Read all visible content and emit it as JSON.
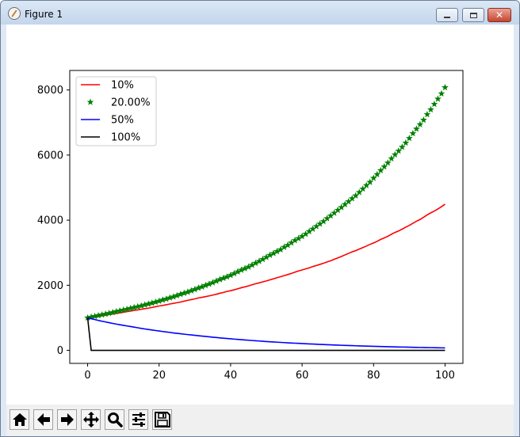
{
  "window": {
    "title": "Figure 1"
  },
  "toolbar": {
    "buttons": [
      {
        "name": "home",
        "icon": "home-icon"
      },
      {
        "name": "back",
        "icon": "arrow-left-icon"
      },
      {
        "name": "forward",
        "icon": "arrow-right-icon"
      },
      {
        "name": "pan",
        "icon": "move-icon"
      },
      {
        "name": "zoom",
        "icon": "magnifier-icon"
      },
      {
        "name": "configure-subplots",
        "icon": "sliders-icon"
      },
      {
        "name": "save",
        "icon": "floppy-disk-icon"
      }
    ]
  },
  "chart_data": {
    "type": "line",
    "title": "",
    "xlabel": "",
    "ylabel": "",
    "xlim": [
      -5,
      105
    ],
    "ylim": [
      -400,
      8600
    ],
    "xticks": [
      0,
      20,
      40,
      60,
      80,
      100
    ],
    "yticks": [
      0,
      2000,
      4000,
      6000,
      8000
    ],
    "legend_placement": "upper-left",
    "grid": false,
    "series": [
      {
        "name": "10%",
        "style": "line",
        "color": "#ff0000",
        "rate": 0.015,
        "n": 101
      },
      {
        "name": "20.00%",
        "style": "star-markers",
        "color": "#008000",
        "rate": 0.0212,
        "n": 101
      },
      {
        "name": "50%",
        "style": "line",
        "color": "#0000ff",
        "rate": -0.0255,
        "n": 101
      },
      {
        "name": "100%",
        "style": "line",
        "color": "#000000",
        "x": [
          0,
          1,
          100
        ],
        "y": [
          1000,
          0,
          0
        ]
      }
    ],
    "start_value": 1000
  }
}
